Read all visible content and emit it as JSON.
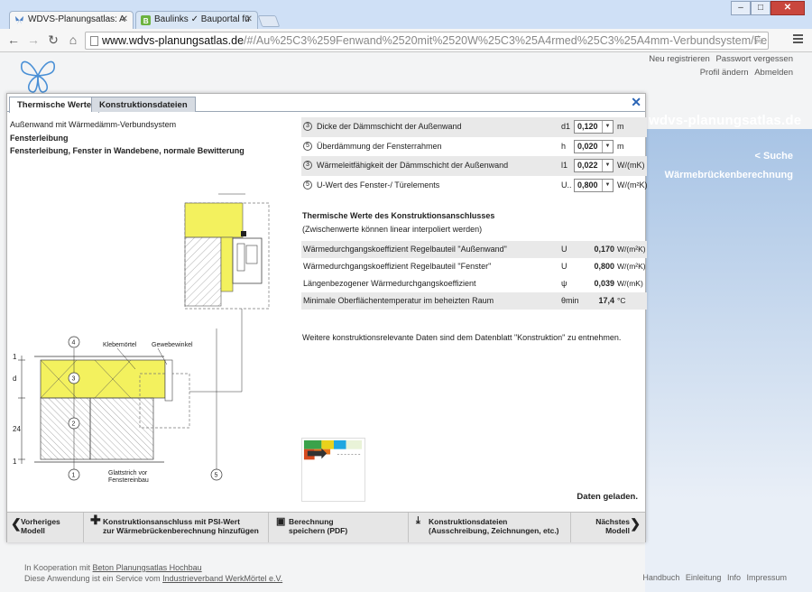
{
  "browser": {
    "tabs": [
      {
        "title": "WDVS-Planungsatlas: A"
      },
      {
        "title": "Baulinks ✓ Bauportal fü"
      }
    ],
    "url_host": "www.wdvs-planungsatlas.de",
    "url_path": "/#/Au%25C3%259Fenwand%2520mit%2520W%25C3%25A4rmed%25C3%25A4mm-Verbundsystem/Fensterleibung,"
  },
  "header": {
    "links_row1": [
      "Neu registrieren",
      "Passwort vergessen"
    ],
    "links_row2": [
      "Profil ändern",
      "Abmelden"
    ],
    "site_name": "wdvs-planungsatlas.de"
  },
  "sidebar": {
    "search": "< Suche",
    "calc": "Wärmebrückenberechnung"
  },
  "dialog": {
    "tabs": [
      "Thermische Werte",
      "Konstruktionsdateien"
    ],
    "context": [
      "Außenwand mit Wärmedämm-Verbundsystem",
      "Fensterleibung",
      "Fensterleibung, Fenster in Wandebene, normale Bewitterung"
    ],
    "params": [
      {
        "num": "3",
        "label": "Dicke der Dämmschicht der Außenwand",
        "sym": "d1",
        "value": "0,120",
        "unit": "m"
      },
      {
        "num": "5",
        "label": "Überdämmung der Fensterrahmen",
        "sym": "h",
        "value": "0,020",
        "unit": "m"
      },
      {
        "num": "3",
        "label": "Wärmeleitfähigkeit der Dämmschicht der Außenwand",
        "sym": "l1",
        "value": "0,022",
        "unit": "W/(mK)"
      },
      {
        "num": "5",
        "label": "U-Wert des Fenster-/ Türelements",
        "sym": "U..",
        "value": "0,800",
        "unit": "W/(m²K)"
      }
    ],
    "thermo_title": "Thermische Werte des Konstruktionsanschlusses",
    "thermo_sub": "(Zwischenwerte können linear interpoliert werden)",
    "results": [
      {
        "label": "Wärmedurchgangskoeffizient Regelbauteil \"Außenwand\"",
        "sym": "U",
        "value": "0,170",
        "unit": "W/(m²K)"
      },
      {
        "label": "Wärmedurchgangskoeffizient Regelbauteil \"Fenster\"",
        "sym": "U",
        "value": "0,800",
        "unit": "W/(m²K)"
      },
      {
        "label": "Längenbezogener Wärmedurchgangskoeffizient",
        "sym": "ψ",
        "value": "0,039",
        "unit": "W/(mK)"
      },
      {
        "label": "Minimale Oberflächentemperatur im beheizten Raum",
        "sym": "θmin",
        "value": "17,4",
        "unit": "°C"
      }
    ],
    "note": "Weitere konstruktionsrelevante Daten sind dem Datenblatt \"Konstruktion\" zu entnehmen.",
    "status": "Daten geladen.",
    "drawing_labels": {
      "h": "h",
      "klebemoertel": "Klebemörtel",
      "gewebewinkel": "Gewebewinkel",
      "glattstrich1": "Glattstrich vor",
      "glattstrich2": "Fenstereinbau",
      "d1": "d",
      "dim24": "24",
      "dim1a": "1",
      "dim1b": "1",
      "n1": "1",
      "n2": "2",
      "n3": "3",
      "n4": "4",
      "n5": "5"
    },
    "footer": {
      "prev1": "Vorheriges",
      "prev2": "Modell",
      "add1": "Konstruktionsanschluss mit PSI-Wert",
      "add2": "zur Wärmebrückenberechnung hinzufügen",
      "save1": "Berechnung",
      "save2": "speichern (PDF)",
      "files1": "Konstruktionsdateien",
      "files2": "(Ausschreibung, Zeichnungen, etc.)",
      "next1": "Nächstes",
      "next2": "Modell"
    }
  },
  "page_footer": {
    "coop_prefix": "In Kooperation mit ",
    "coop_link": "Beton Planungsatlas Hochbau",
    "service_prefix": "Diese Anwendung ist ein Service vom ",
    "service_link": "Industrieverband WerkMörtel e.V.",
    "links": [
      "Handbuch",
      "Einleitung",
      "Info",
      "Impressum"
    ]
  }
}
